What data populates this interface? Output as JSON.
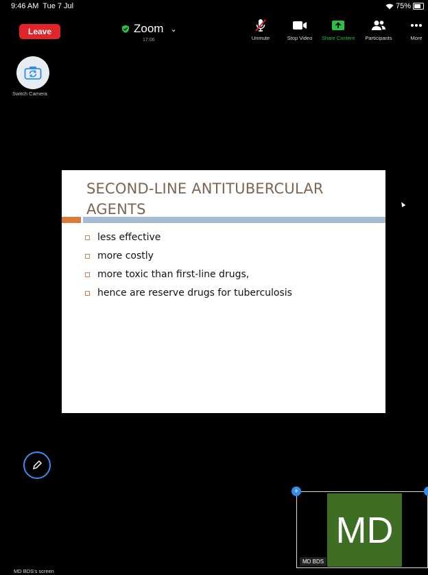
{
  "status": {
    "time": "9:46 AM",
    "date": "Tue 7 Jul",
    "battery": "75%"
  },
  "toolbar": {
    "leave_label": "Leave",
    "title": "Zoom",
    "elapsed": "17:06",
    "items": [
      {
        "label": "Unmute",
        "icon": "mic-muted-icon"
      },
      {
        "label": "Stop Video",
        "icon": "video-camera-icon"
      },
      {
        "label": "Share Content",
        "icon": "share-screen-icon"
      },
      {
        "label": "Participants",
        "icon": "participants-icon"
      },
      {
        "label": "More",
        "icon": "more-icon"
      }
    ]
  },
  "switch_camera_label": "Switch Camera",
  "slide": {
    "title": "SECOND-LINE ANTITUBERCULAR AGENTS",
    "bullets": [
      "less effective",
      "more costly",
      "more toxic than first-line drugs,",
      "hence are reserve drugs for tuberculosis"
    ]
  },
  "thumbnail": {
    "initials": "MD",
    "name": "MD BDS"
  },
  "screen_label": "MD BDS's screen",
  "colors": {
    "leave": "#e0252b",
    "share": "#2bbf45",
    "avatar": "#3d6e23",
    "accent": "#2f8cf0"
  }
}
